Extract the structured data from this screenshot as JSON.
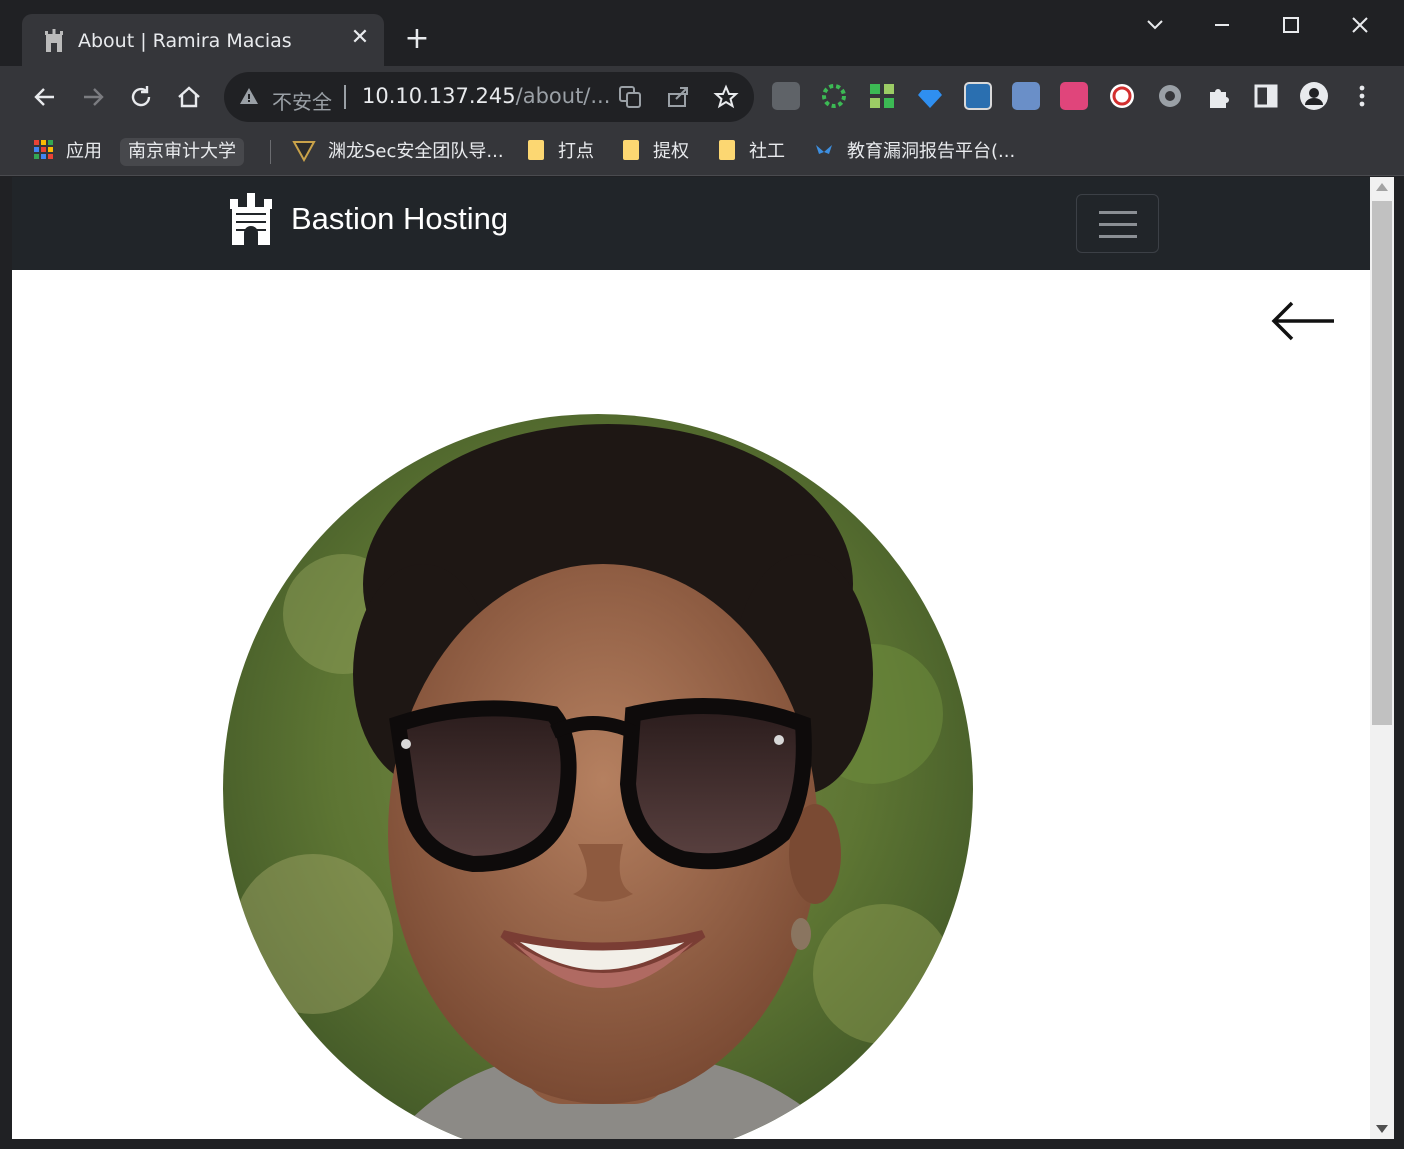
{
  "browser": {
    "tab": {
      "title": "About | Ramira Macias",
      "close_label": "✕"
    },
    "new_tab_label": "+",
    "window_controls": {
      "dropdown": "⌄",
      "minimize": "—",
      "maximize": "☐",
      "close": "✕"
    },
    "omnibox": {
      "security_label": "不安全",
      "url_host": "10.10.137.245",
      "url_path": "/about/..."
    },
    "bookmarks": [
      {
        "label": "应用",
        "icon": "apps-grid-icon"
      },
      {
        "label": "南京审计大学",
        "icon": "none"
      },
      {
        "label": "渊龙Sec安全团队导...",
        "icon": "dragon-logo-icon"
      },
      {
        "label": "打点",
        "icon": "folder-icon"
      },
      {
        "label": "提权",
        "icon": "folder-icon"
      },
      {
        "label": "社工",
        "icon": "folder-icon"
      },
      {
        "label": "教育漏洞报告平台(...",
        "icon": "butterfly-icon"
      }
    ],
    "colors": {
      "tabstrip": "#202124",
      "toolbar": "#35363a",
      "omnibox": "#202124"
    }
  },
  "page": {
    "navbar": {
      "brand_name": "Bastion Hosting",
      "background": "#212529"
    },
    "back_link_icon": "arrow-left-icon",
    "profile_photo": "woman-with-sunglasses-portrait"
  }
}
